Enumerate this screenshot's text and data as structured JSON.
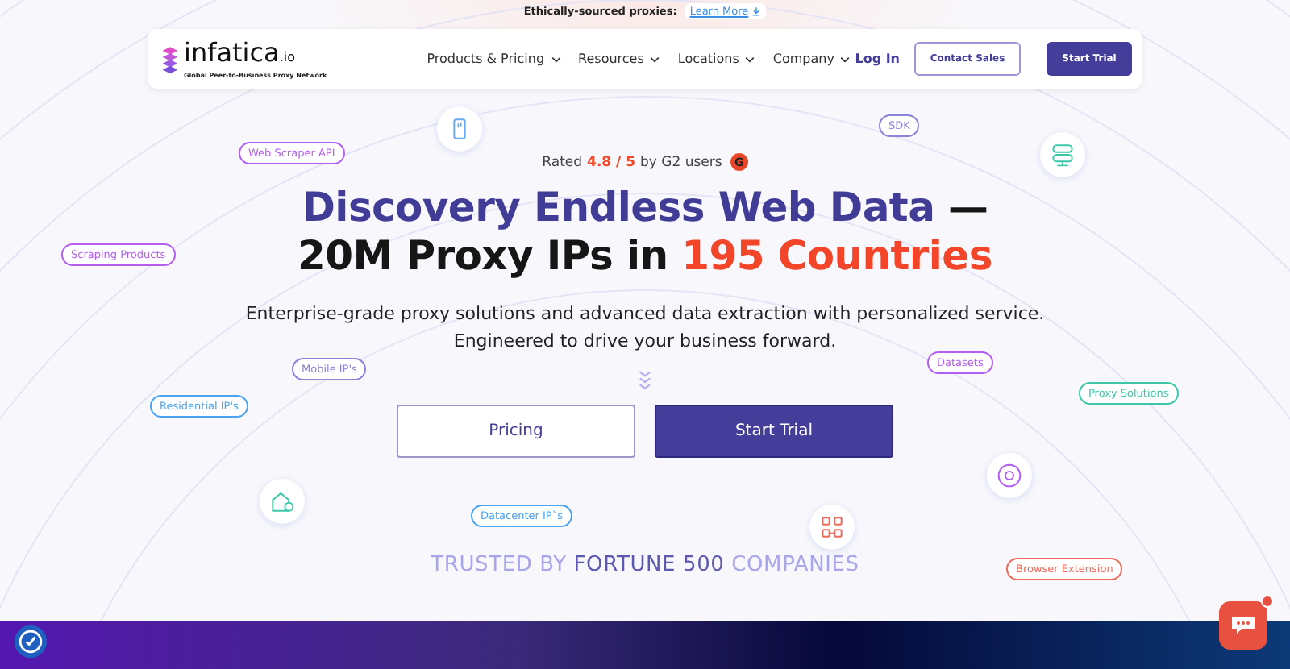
{
  "announcement": {
    "text": "Ethically-sourced proxies:",
    "link": "Learn More"
  },
  "nav": {
    "logo": {
      "name": "infatica",
      "suffix": ".io",
      "tagline": "Global Peer-to-Business Proxy Network"
    },
    "menu": [
      "Products & Pricing",
      "Resources",
      "Locations",
      "Company"
    ],
    "login": "Log In",
    "contact": "Contact Sales",
    "trial": "Start Trial"
  },
  "rating": {
    "prefix": "Rated",
    "score": "4.8 / 5",
    "suffix": "by G2 users",
    "badge": "G"
  },
  "headline": [
    {
      "parts": [
        {
          "text": "Discovery Endless Web Data",
          "kind": "accent"
        },
        {
          "text": " —",
          "kind": "plain"
        }
      ]
    },
    {
      "parts": [
        {
          "text": "20M Proxy IPs in ",
          "kind": "plain"
        },
        {
          "text": "195 Countries",
          "kind": "highlight"
        }
      ]
    }
  ],
  "subtitle": [
    "Enterprise-grade proxy solutions and advanced data extraction with personalized service.",
    "Engineered to drive your business forward."
  ],
  "buttons": [
    {
      "label": "Pricing",
      "kind": "outline"
    },
    {
      "label": "Start Trial",
      "kind": "primary"
    }
  ],
  "trusted": [
    {
      "text": "TRUSTED BY ",
      "kind": "light"
    },
    {
      "text": "FORTUNE 500",
      "kind": "dark"
    },
    {
      "text": " COMPANIES",
      "kind": "light"
    }
  ],
  "tags": [
    {
      "label": "Web Scraper API",
      "color": "#b45ff0"
    },
    {
      "label": "SDK",
      "color": "#8a84d8"
    },
    {
      "label": "Scraping Products",
      "color": "#b45ff0"
    },
    {
      "label": "Mobile IP's",
      "color": "#8a84d8"
    },
    {
      "label": "Datasets",
      "color": "#b45ff0"
    },
    {
      "label": "Residential IP's",
      "color": "#4aa3f0"
    },
    {
      "label": "Proxy Solutions",
      "color": "#3cc7a8"
    },
    {
      "label": "Datacenter IP`s",
      "color": "#4aa3f0"
    },
    {
      "label": "Browser Extension",
      "color": "#f06a5a"
    }
  ]
}
